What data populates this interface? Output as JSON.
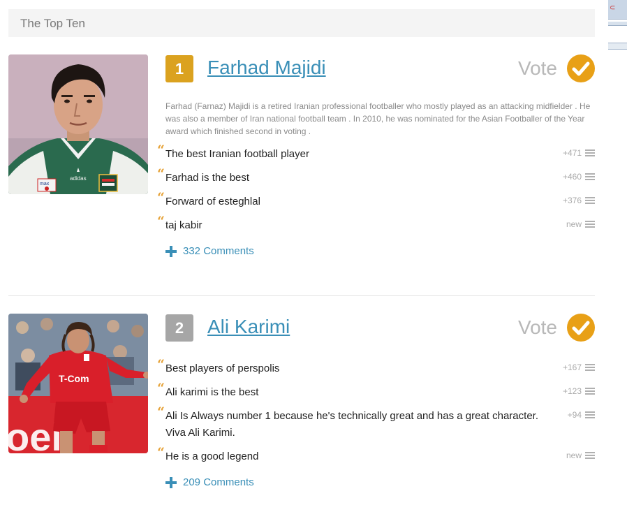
{
  "header": {
    "title": "The Top Ten"
  },
  "colors": {
    "rank_first": "#dba21f",
    "rank_other": "#a6a6a6",
    "vote_accent": "#e8a017",
    "link": "#3a8fb7"
  },
  "entries": [
    {
      "rank": "1",
      "name": "Farhad Majidi",
      "vote_label": "Vote",
      "description": "Farhad (Farnaz) Majidi is a retired Iranian professional footballer who mostly played as an attacking midfielder . He was also a member of Iran national football team . In 2010, he was nominated for the Asian Footballer of the Year award which finished second in voting .",
      "photo_lettering": [
        "max",
        "adidas"
      ],
      "reasons": [
        {
          "text": "The best Iranian football player",
          "score": "+471"
        },
        {
          "text": "Farhad is the best",
          "score": "+460"
        },
        {
          "text": "Forward of esteghlal",
          "score": "+376"
        },
        {
          "text": "taj kabir",
          "score": "new"
        }
      ],
      "comments": "332 Comments"
    },
    {
      "rank": "2",
      "name": "Ali Karimi",
      "vote_label": "Vote",
      "photo_lettering": [
        "T-Com"
      ],
      "reasons": [
        {
          "text": "Best players of perspolis",
          "score": "+167"
        },
        {
          "text": "Ali karimi is the best",
          "score": "+123"
        },
        {
          "text": "Ali Is Always number 1 because he's technically great and has a great character. Viva Ali Karimi.",
          "score": "+94"
        },
        {
          "text": "He is a good legend",
          "score": "new"
        }
      ],
      "comments": "209 Comments"
    }
  ]
}
